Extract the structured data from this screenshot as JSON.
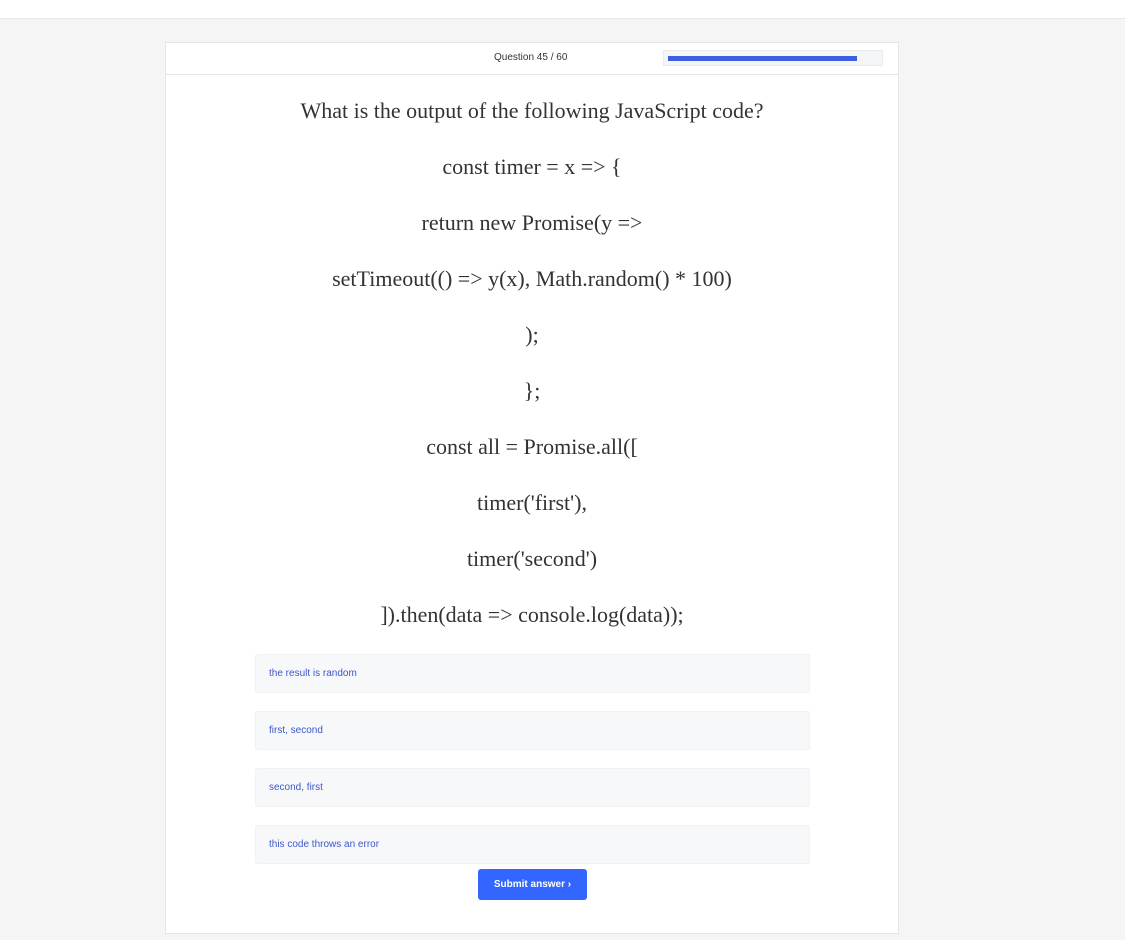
{
  "header": {
    "question_counter": "Question 45 / 60",
    "progress": 0.9
  },
  "question": {
    "lines": [
      "What is the output of the following JavaScript code?",
      "const timer = x => {",
      "return new Promise(y =>",
      "setTimeout(() => y(x), Math.random() * 100)",
      ");",
      "};",
      "const all = Promise.all([",
      "timer('first'),",
      "timer('second')",
      "]).then(data => console.log(data));"
    ]
  },
  "options": [
    "the result is random",
    "first, second",
    "second, first",
    "this code throws an error"
  ],
  "submit_label": "Submit answer ›",
  "colors": {
    "accent": "#3366ff",
    "progress_fill": "#3b5fe0",
    "option_text": "#3d57c9",
    "option_bg": "#f7f8fa"
  }
}
